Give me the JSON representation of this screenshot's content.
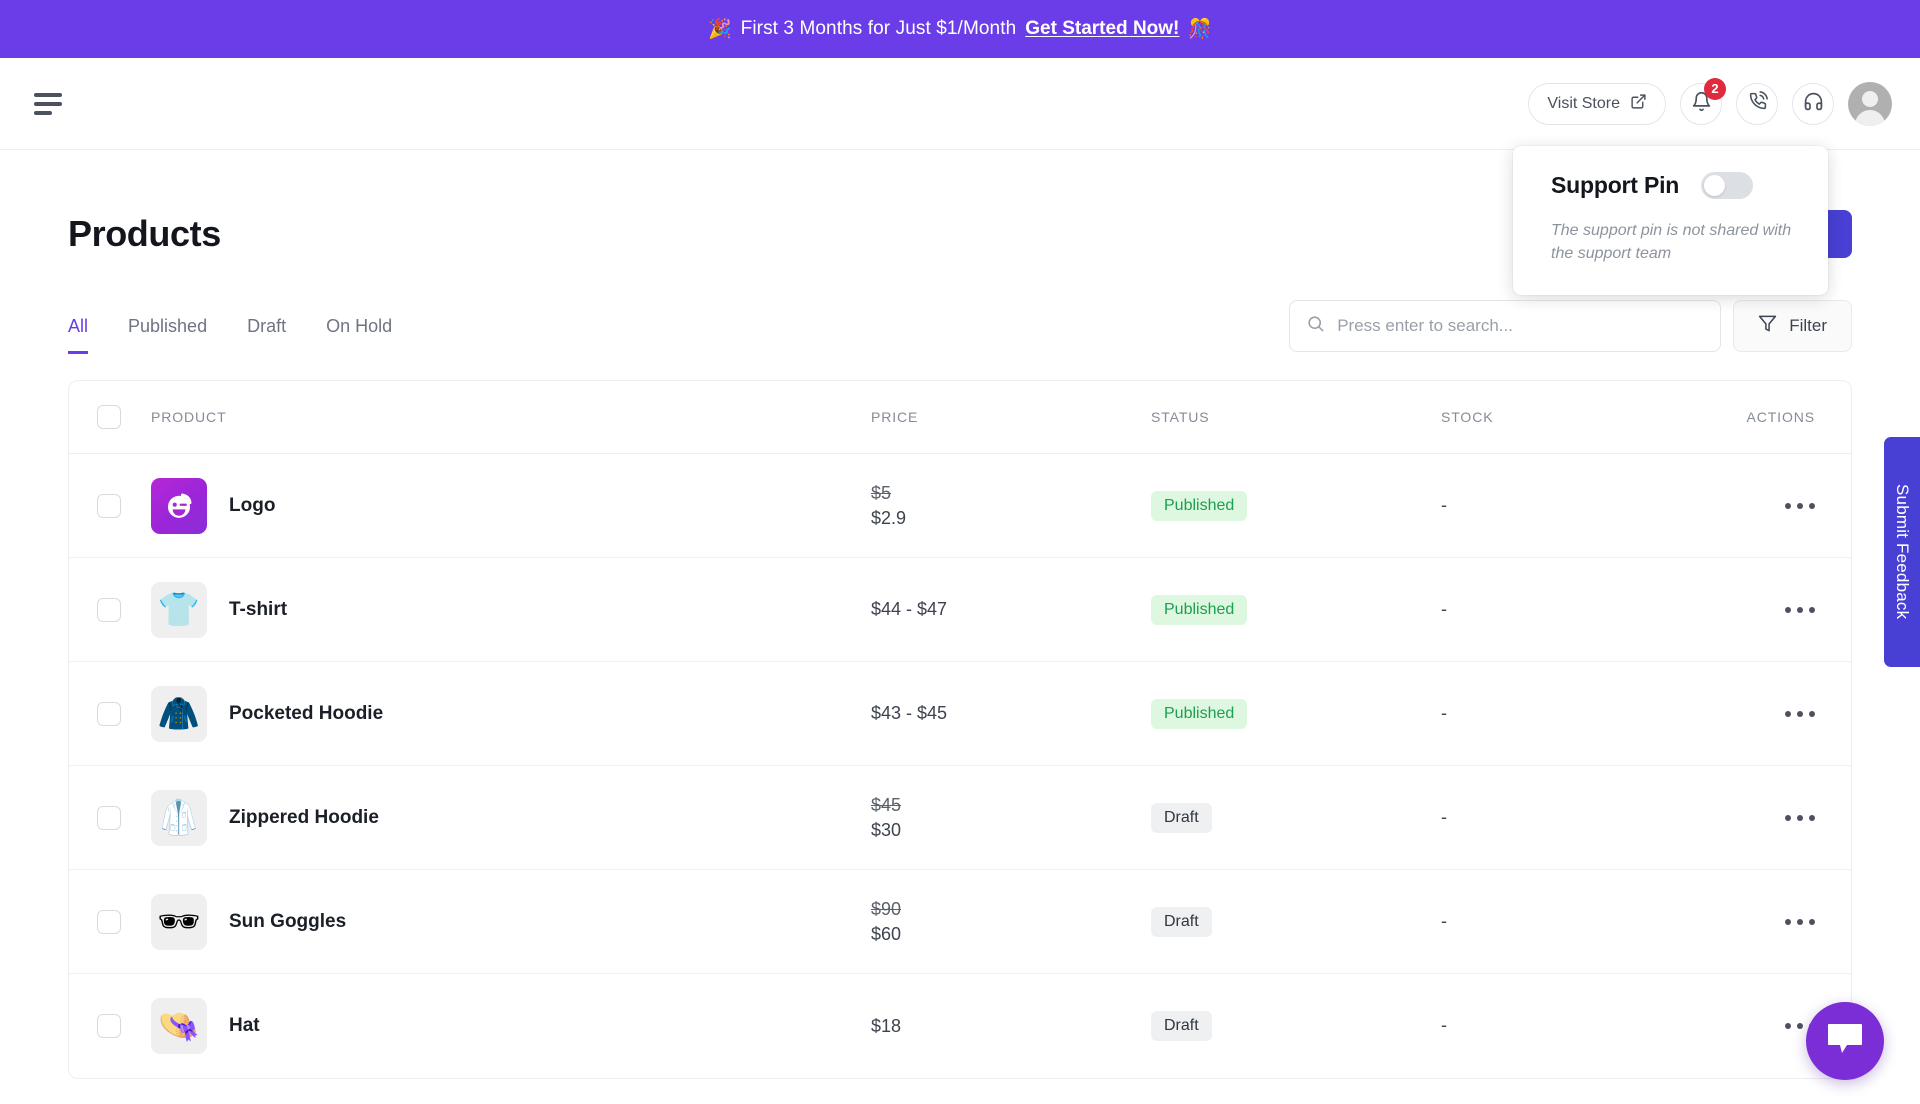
{
  "promo": {
    "left_emoji": "🎉",
    "text": "First 3 Months for Just $1/Month",
    "link_label": "Get Started Now!",
    "right_emoji": "🎊",
    "background": "#6a3de8"
  },
  "header": {
    "menu_label": "Menu",
    "visit_store_label": "Visit Store",
    "notification_count": "2",
    "icons": [
      "bell-icon",
      "phone-ring-icon",
      "headset-icon",
      "avatar"
    ]
  },
  "support_pin": {
    "title": "Support Pin",
    "toggle_state": "off",
    "description": "The support pin is not shared with the support team"
  },
  "page": {
    "title": "Products",
    "secondary_button_label": "",
    "primary_button_label": ""
  },
  "tabs": [
    {
      "label": "All",
      "active": true
    },
    {
      "label": "Published",
      "active": false
    },
    {
      "label": "Draft",
      "active": false
    },
    {
      "label": "On Hold",
      "active": false
    }
  ],
  "search": {
    "value": "",
    "placeholder": "Press enter to search..."
  },
  "filter": {
    "label": "Filter"
  },
  "table": {
    "columns": [
      "PRODUCT",
      "PRICE",
      "STATUS",
      "STOCK",
      "ACTIONS"
    ],
    "rows": [
      {
        "name": "Logo",
        "thumb": "logo-smiley-icon",
        "price_old": "$5",
        "price_new": "$2.9",
        "price_range": "",
        "status": "Published",
        "status_kind": "published",
        "stock": "-"
      },
      {
        "name": "T-shirt",
        "thumb": "👕",
        "price_old": "",
        "price_new": "",
        "price_range": "$44 - $47",
        "status": "Published",
        "status_kind": "published",
        "stock": "-"
      },
      {
        "name": "Pocketed Hoodie",
        "thumb": "🧥",
        "price_old": "",
        "price_new": "",
        "price_range": "$43 - $45",
        "status": "Published",
        "status_kind": "published",
        "stock": "-"
      },
      {
        "name": "Zippered Hoodie",
        "thumb": "🥼",
        "price_old": "$45",
        "price_new": "$30",
        "price_range": "",
        "status": "Draft",
        "status_kind": "draft",
        "stock": "-"
      },
      {
        "name": "Sun Goggles",
        "thumb": "🕶",
        "price_old": "$90",
        "price_new": "$60",
        "price_range": "",
        "status": "Draft",
        "status_kind": "draft",
        "stock": "-"
      },
      {
        "name": "Hat",
        "thumb": "👒",
        "price_old": "",
        "price_new": "",
        "price_range": "$18",
        "status": "Draft",
        "status_kind": "draft",
        "stock": "-"
      }
    ]
  },
  "feedback": {
    "label": "Submit Feedback",
    "color": "#4840d4"
  },
  "chat": {
    "label": "chat-bubble-icon",
    "color": "#7b2ed6"
  }
}
